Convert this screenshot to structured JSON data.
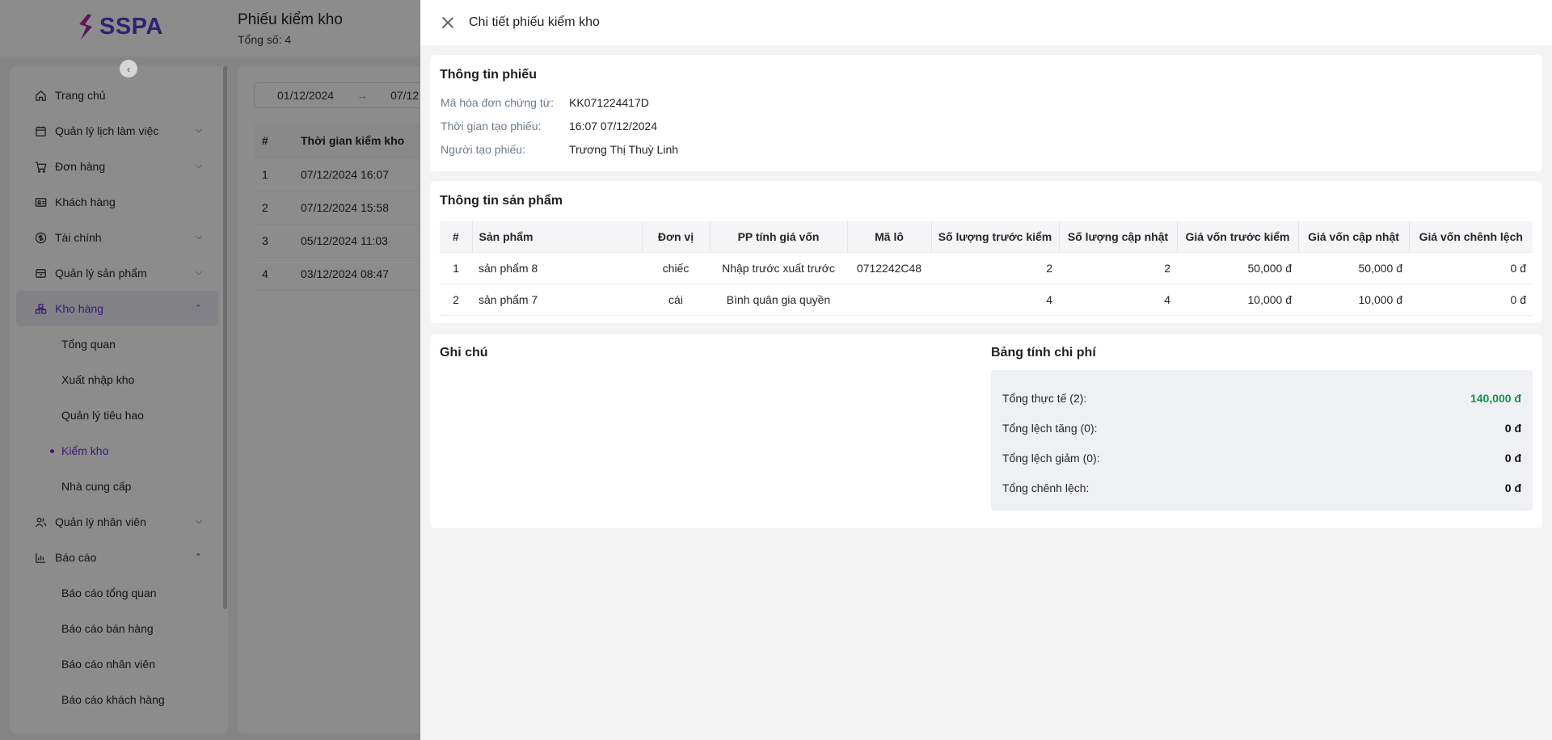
{
  "app": {
    "brand": "SSPA",
    "page_title": "Phiếu kiểm kho",
    "total_label": "Tổng số: 4"
  },
  "sidebar": {
    "items": [
      {
        "label": "Trang chủ",
        "icon": "home-icon",
        "expandable": false
      },
      {
        "label": "Quản lý lịch làm việc",
        "icon": "calendar-icon",
        "expandable": true
      },
      {
        "label": "Đơn hàng",
        "icon": "cart-icon",
        "expandable": true
      },
      {
        "label": "Khách hàng",
        "icon": "id-card-icon",
        "expandable": false
      },
      {
        "label": "Tài chính",
        "icon": "dollar-icon",
        "expandable": true
      },
      {
        "label": "Quản lý sản phẩm",
        "icon": "box-icon",
        "expandable": true
      },
      {
        "label": "Kho hàng",
        "icon": "warehouse-icon",
        "expandable": true,
        "open": true
      },
      {
        "label": "Quản lý nhân viên",
        "icon": "users-icon",
        "expandable": true
      },
      {
        "label": "Báo cáo",
        "icon": "bar-chart-icon",
        "expandable": true,
        "open": true
      }
    ],
    "warehouse_sub": [
      "Tổng quan",
      "Xuất nhập kho",
      "Quản lý tiêu hao",
      "Kiểm kho",
      "Nhà cung cấp"
    ],
    "report_sub": [
      "Báo cáo tổng quan",
      "Báo cáo bán hàng",
      "Báo cáo nhân viên",
      "Báo cáo khách hàng"
    ]
  },
  "list": {
    "date_from": "01/12/2024",
    "date_to": "07/12",
    "date_arrow": "→",
    "headers": [
      "#",
      "Thời gian kiểm kho"
    ],
    "rows": [
      [
        "1",
        "07/12/2024 16:07"
      ],
      [
        "2",
        "07/12/2024 15:58"
      ],
      [
        "3",
        "05/12/2024 11:03"
      ],
      [
        "4",
        "03/12/2024 08:47"
      ]
    ]
  },
  "drawer": {
    "title": "Chi tiết phiếu kiểm kho",
    "info": {
      "title": "Thông tin phiếu",
      "rows": [
        {
          "label": "Mã hóa đơn chứng từ:",
          "value": "KK071224417D"
        },
        {
          "label": "Thời gian tạo phiếu:",
          "value": "16:07 07/12/2024"
        },
        {
          "label": "Người tạo phiếu:",
          "value": "Trương Thị Thuỳ Linh"
        }
      ]
    },
    "products": {
      "title": "Thông tin sản phẩm",
      "headers": [
        "#",
        "Sản phẩm",
        "Đơn vị",
        "PP tính giá vốn",
        "Mã lô",
        "Số lượng trước kiểm",
        "Số lượng cập nhật",
        "Giá vốn trước kiểm",
        "Giá vốn cập nhật",
        "Giá vốn chênh lệch"
      ],
      "rows": [
        [
          "1",
          "sản phẩm 8",
          "chiếc",
          "Nhập trước xuất trước",
          "0712242C48",
          "2",
          "2",
          "50,000 đ",
          "50,000 đ",
          "0 đ"
        ],
        [
          "2",
          "sản phẩm 7",
          "cái",
          "Bình quân gia quyền",
          "",
          "4",
          "4",
          "10,000 đ",
          "10,000 đ",
          "0 đ"
        ]
      ]
    },
    "note_title": "Ghi chú",
    "cost": {
      "title": "Bảng tính chi phí",
      "rows": [
        {
          "label": "Tổng thực tế (2):",
          "value": "140,000 đ"
        },
        {
          "label": "Tổng lệch tăng (0):",
          "value": "0 đ"
        },
        {
          "label": "Tổng lệch giảm (0):",
          "value": "0 đ"
        },
        {
          "label": "Tổng chênh lệch:",
          "value": "0 đ"
        }
      ]
    }
  },
  "colors": {
    "brand": "#5a3fd0",
    "active_menu": "#6b2fd6",
    "positive_amount": "#12924a"
  }
}
